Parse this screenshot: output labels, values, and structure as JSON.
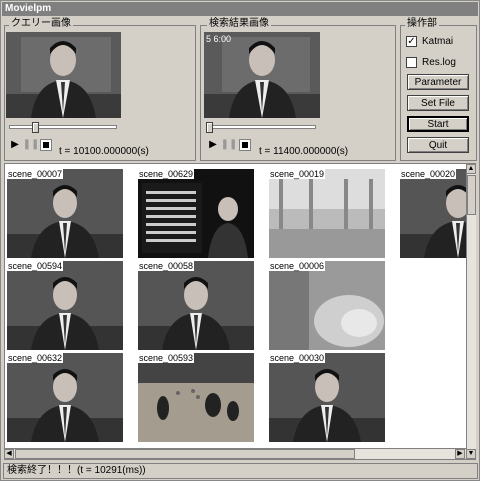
{
  "window": {
    "title": "Movielpm"
  },
  "query_panel": {
    "label": "クエリー画像",
    "time_text": "t = 10100.000000(s)"
  },
  "result_panel": {
    "label": "検索結果画像",
    "time_text": "t = 11400.000000(s)",
    "overlay": "5 6:00"
  },
  "ops": {
    "label": "操作部",
    "katmai_label": "Katmai",
    "katmai_checked": true,
    "reslog_label": "Res.log",
    "reslog_checked": false,
    "parameter_label": "Parameter",
    "setfile_label": "Set File",
    "start_label": "Start",
    "quit_label": "Quit"
  },
  "results": [
    {
      "name": "scene_00007",
      "kind": "anchor"
    },
    {
      "name": "scene_00629",
      "kind": "scoreboard"
    },
    {
      "name": "scene_00019",
      "kind": "hall"
    },
    {
      "name": "scene_00020",
      "kind": "anchor"
    },
    {
      "name": "scene_00594",
      "kind": "anchor"
    },
    {
      "name": "scene_00058",
      "kind": "anchor"
    },
    {
      "name": "scene_00006",
      "kind": "closeup"
    },
    {
      "name": "scene_00632",
      "kind": "anchor"
    },
    {
      "name": "scene_00593",
      "kind": "dance"
    },
    {
      "name": "scene_00030",
      "kind": "anchor"
    }
  ],
  "status": {
    "text": "検索終了！！！(t = 10291(ms))"
  },
  "icons": {
    "play": "play-icon",
    "pause": "pause-icon",
    "stop": "stop-icon"
  }
}
